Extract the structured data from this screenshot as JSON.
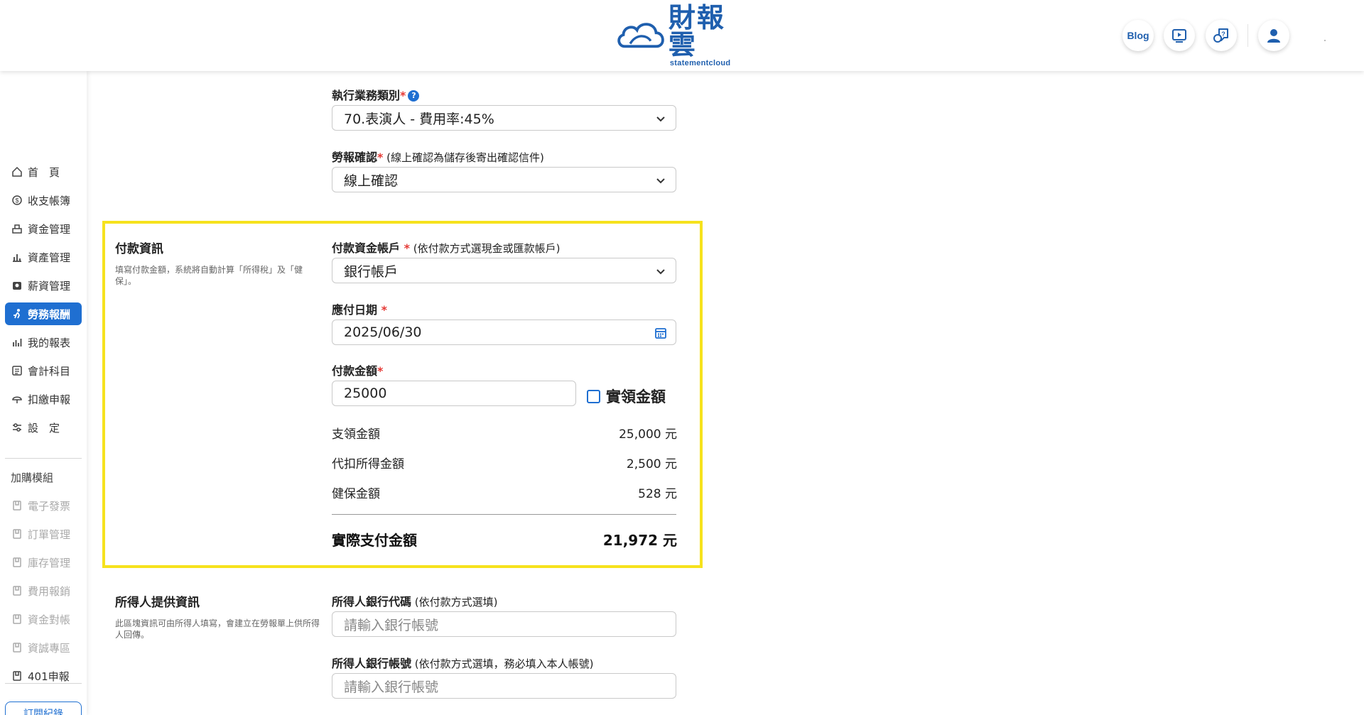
{
  "brand": {
    "name": "財報雲",
    "sub": "statementcloud",
    "color": "#1f5fae"
  },
  "header": {
    "blog_label": "Blog",
    "icons": [
      "video-tutorial-icon",
      "chat-help-icon",
      "user-account-icon"
    ]
  },
  "sidebar": {
    "items": [
      {
        "label": "首　頁",
        "icon": "home-icon"
      },
      {
        "label": "收支帳簿",
        "icon": "money-book-icon"
      },
      {
        "label": "資金管理",
        "icon": "fund-icon"
      },
      {
        "label": "資產管理",
        "icon": "asset-icon"
      },
      {
        "label": "薪資管理",
        "icon": "payroll-icon"
      },
      {
        "label": "勞務報酬",
        "icon": "labor-icon",
        "active": true
      },
      {
        "label": "我的報表",
        "icon": "report-icon"
      },
      {
        "label": "會計科目",
        "icon": "account-icon"
      },
      {
        "label": "扣繳申報",
        "icon": "tax-icon"
      },
      {
        "label": "設　定",
        "icon": "settings-icon"
      }
    ],
    "addon_title": "加購模組",
    "addons": [
      {
        "label": "電子發票",
        "disabled": true
      },
      {
        "label": "訂單管理",
        "disabled": true
      },
      {
        "label": "庫存管理",
        "disabled": true
      },
      {
        "label": "費用報銷",
        "disabled": true
      },
      {
        "label": "資金對帳",
        "disabled": true
      },
      {
        "label": "資誠專區",
        "disabled": true
      },
      {
        "label": "401申報",
        "disabled": false
      }
    ],
    "subscription_label": "訂閱紀錄"
  },
  "form": {
    "business_type": {
      "label": "執行業務類別",
      "required": "*",
      "value": "70.表演人 - 費用率:45%"
    },
    "confirm": {
      "label": "勞報確認",
      "required": "*",
      "note": " (線上確認為儲存後寄出確認信件)",
      "value": "線上確認"
    },
    "payment_section": {
      "title": "付款資訊",
      "desc": "填寫付款金額，系統將自動計算「所得稅」及「健保」。",
      "account": {
        "label": "付款資金帳戶",
        "required": " *",
        "note": " (依付款方式選現金或匯款帳戶)",
        "value": "銀行帳戶"
      },
      "due_date": {
        "label": "應付日期",
        "required": " *",
        "value": "2025/06/30"
      },
      "amount": {
        "label": "付款金額",
        "required": "*",
        "value": "25000",
        "checkbox_label": "實領金額"
      },
      "rows": [
        {
          "label": "支領金額",
          "value": "25,000 元"
        },
        {
          "label": "代扣所得金額",
          "value": "2,500 元"
        },
        {
          "label": "健保金額",
          "value": "528 元"
        }
      ],
      "total": {
        "label": "實際支付金額",
        "value": "21,972 元"
      }
    },
    "payee_section": {
      "title": "所得人提供資訊",
      "desc": "此區塊資訊可由所得人填寫，會建立在勞報單上供所得人回傳。",
      "bank_code": {
        "label": "所得人銀行代碼",
        "note": " (依付款方式選填)",
        "placeholder": "請輸入銀行帳號"
      },
      "bank_account": {
        "label": "所得人銀行帳號",
        "note": " (依付款方式選填，務必填入本人帳號)",
        "placeholder": "請輸入銀行帳號"
      }
    }
  }
}
